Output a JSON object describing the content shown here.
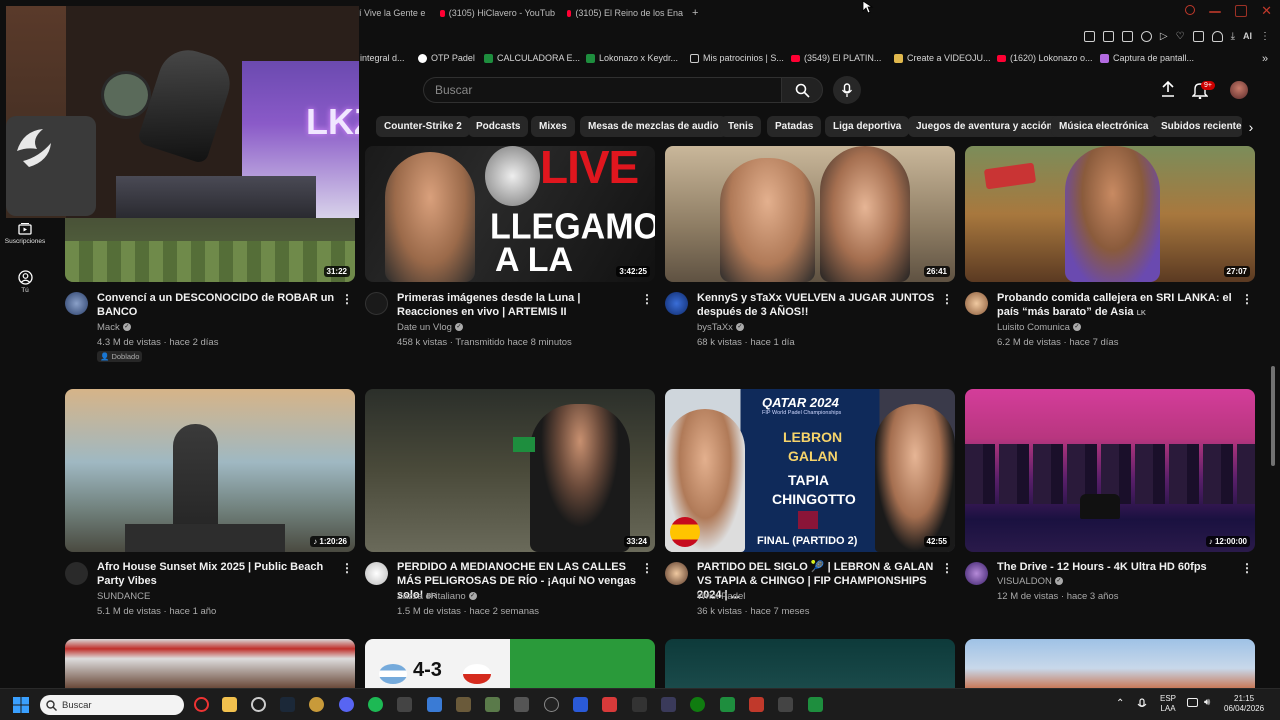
{
  "tabs": [
    {
      "label": "í Vive la Gente e"
    },
    {
      "label": "(3105) HiClavero - YouTub"
    },
    {
      "label": "(3105) El Reino de los Ena"
    }
  ],
  "new_tab_label": "+",
  "bookmarks": [
    {
      "label": "integral d..."
    },
    {
      "label": "OTP Padel"
    },
    {
      "label": "CALCULADORA E..."
    },
    {
      "label": "Lokonazo x Keydr..."
    },
    {
      "label": "Mis patrocinios | S..."
    },
    {
      "label": "(3549) El PLATIN..."
    },
    {
      "label": "Create a VIDEOJU..."
    },
    {
      "label": "(1620) Lokonazo o..."
    },
    {
      "label": "Captura de pantall..."
    }
  ],
  "ai_label": "AI",
  "search": {
    "placeholder": "Buscar"
  },
  "notifications_badge": "9+",
  "chips": [
    "Counter-Strike 2",
    "Podcasts",
    "Mixes",
    "Mesas de mezclas de audio",
    "Tenis",
    "Patadas",
    "Liga deportiva",
    "Juegos de aventura y acción",
    "Música electrónica",
    "Subidos recientem"
  ],
  "nav": [
    {
      "label": "Suscripciones",
      "icon": "subscriptions-icon"
    },
    {
      "label": "Tú",
      "icon": "you-icon"
    }
  ],
  "videos": [
    {
      "title": "Convencí a un DESCONOCIDO de ROBAR un BANCO",
      "channel": "Mack",
      "verified": true,
      "meta": "4.3 M de vistas · hace 2 días",
      "duration": "31:22",
      "badge": "Doblado"
    },
    {
      "title": "Primeras imágenes desde la Luna | Reacciones en vivo | ARTEMIS II",
      "channel": "Date un Vlog",
      "verified": true,
      "meta": "458 k vistas · Transmitido hace 8 minutos",
      "duration": "3:42:25",
      "thumb_text_1": "LIVE",
      "thumb_text_2": "LLEGAMOS",
      "thumb_text_3": "A LA LUNA"
    },
    {
      "title": "KennyS y sTaXx VUELVEN a JUGAR JUNTOS después de 3 AÑOS!!",
      "channel": "bysTaXx",
      "verified": true,
      "meta": "68 k vistas · hace 1 día",
      "duration": "26:41"
    },
    {
      "title": "Probando comida callejera en SRI LANKA: el país “más barato” de Asia",
      "title_suffix": "LK",
      "channel": "Luisito Comunica",
      "verified": true,
      "meta": "6.2 M de vistas · hace 7 días",
      "duration": "27:07"
    },
    {
      "title": "Afro House Sunset Mix 2025 | Public Beach Party Vibes",
      "channel": "SUNDANCE",
      "verified": false,
      "meta": "5.1 M de vistas · hace 1 año",
      "duration": "♪ 1:20:26"
    },
    {
      "title": "PERDIDO A MEDIANOCHE EN LAS CALLES MÁS PELIGROSAS DE RÍO - ¡Aquí NO vengas solo!",
      "title_suffix": "BR",
      "channel": "Zazza el italiano",
      "verified": true,
      "meta": "1.5 M de vistas · hace 2 semanas",
      "duration": "33:24"
    },
    {
      "title": "PARTIDO DEL SIGLO 🎾 | LEBRON & GALAN VS TAPIA & CHINGO | FIP CHAMPIONSHIPS 2024 | ...",
      "channel": "Wrist Padel",
      "verified": false,
      "meta": "36 k vistas · hace 7 meses",
      "duration": "42:55",
      "thumb_lines": [
        "QATAR 2024",
        "FIP World Padel Championships",
        "LEBRON",
        "GALAN",
        "TAPIA",
        "CHINGOTTO",
        "FINAL (PARTIDO 2)"
      ]
    },
    {
      "title": "The Drive - 12 Hours - 4K Ultra HD 60fps",
      "channel": "VISUALDON",
      "verified": true,
      "meta": "12 M de vistas · hace 3 años",
      "duration": "♪ 12:00:00"
    }
  ],
  "bottom_row_thumb_text": "4-3",
  "taskbar": {
    "search_placeholder": "Buscar",
    "lang_top": "ESP",
    "lang_bottom": "LAA",
    "time": "21:15",
    "date": "06/04/2026"
  }
}
